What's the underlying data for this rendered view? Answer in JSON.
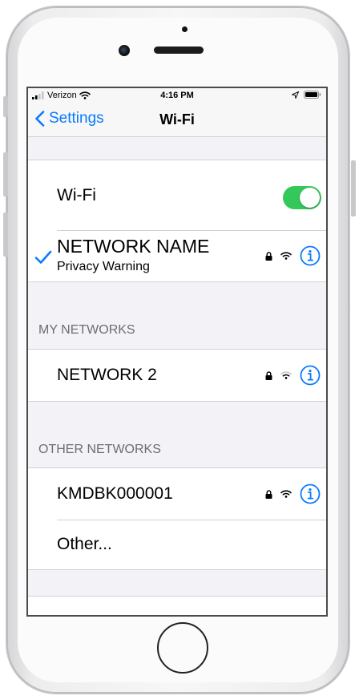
{
  "status_bar": {
    "carrier": "Verizon",
    "time": "4:16 PM"
  },
  "nav": {
    "back_label": "Settings",
    "title": "Wi-Fi"
  },
  "wifi": {
    "label": "Wi-Fi",
    "enabled": true
  },
  "connected": {
    "name": "NETWORK NAME",
    "subtitle": "Privacy Warning"
  },
  "my_networks": {
    "header": "MY NETWORKS",
    "items": [
      {
        "name": "NETWORK 2"
      }
    ]
  },
  "other_networks": {
    "header": "OTHER NETWORKS",
    "items": [
      {
        "name": "KMDBK000001"
      }
    ],
    "other_label": "Other..."
  },
  "colors": {
    "accent": "#0a7aff",
    "toggle_on": "#34c759",
    "background": "#f2f2f7"
  }
}
